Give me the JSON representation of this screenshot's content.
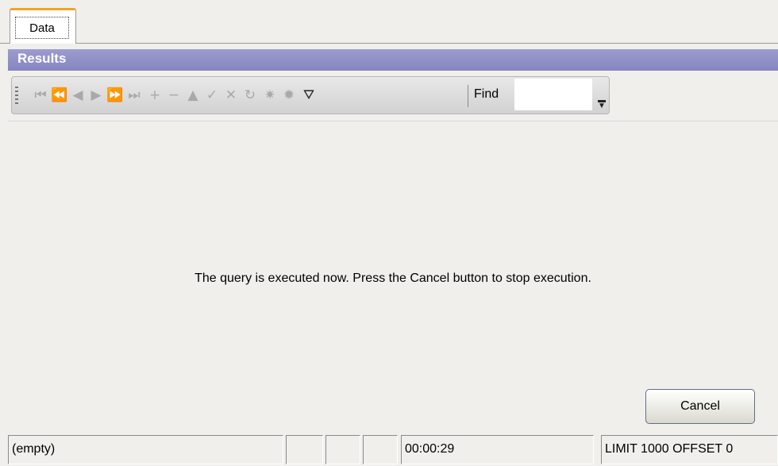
{
  "tab": {
    "label": "Data"
  },
  "panel": {
    "title": "Results"
  },
  "toolbar": {
    "buttons": [
      {
        "name": "first-record-button",
        "glyph": "⏮",
        "enabled": false
      },
      {
        "name": "prior-page-button",
        "glyph": "⏪",
        "enabled": false
      },
      {
        "name": "prior-record-button",
        "glyph": "◀",
        "enabled": false
      },
      {
        "name": "next-record-button",
        "glyph": "▶",
        "enabled": false
      },
      {
        "name": "next-page-button",
        "glyph": "⏩",
        "enabled": false
      },
      {
        "name": "last-record-button",
        "glyph": "⏭",
        "enabled": false
      },
      {
        "name": "insert-record-button",
        "glyph": "+",
        "enabled": false
      },
      {
        "name": "delete-record-button",
        "glyph": "−",
        "enabled": false
      },
      {
        "name": "edit-record-button",
        "glyph": "▲",
        "enabled": false
      },
      {
        "name": "post-edit-button",
        "glyph": "✓",
        "enabled": false
      },
      {
        "name": "cancel-edit-button",
        "glyph": "✕",
        "enabled": false
      },
      {
        "name": "refresh-button",
        "glyph": "↻",
        "enabled": false
      },
      {
        "name": "apply-button",
        "glyph": "✷",
        "enabled": false
      },
      {
        "name": "apply-all-button",
        "glyph": "✹",
        "enabled": false
      },
      {
        "name": "filter-button",
        "glyph": "⛛",
        "enabled": true
      }
    ],
    "find_label": "Find",
    "find_value": ""
  },
  "message": "The query is executed now. Press the Cancel button to stop execution.",
  "cancel_label": "Cancel",
  "status": {
    "state": "(empty)",
    "cells": [
      "",
      "",
      "",
      ""
    ],
    "elapsed": "00:00:29",
    "limit": "LIMIT 1000 OFFSET 0"
  }
}
